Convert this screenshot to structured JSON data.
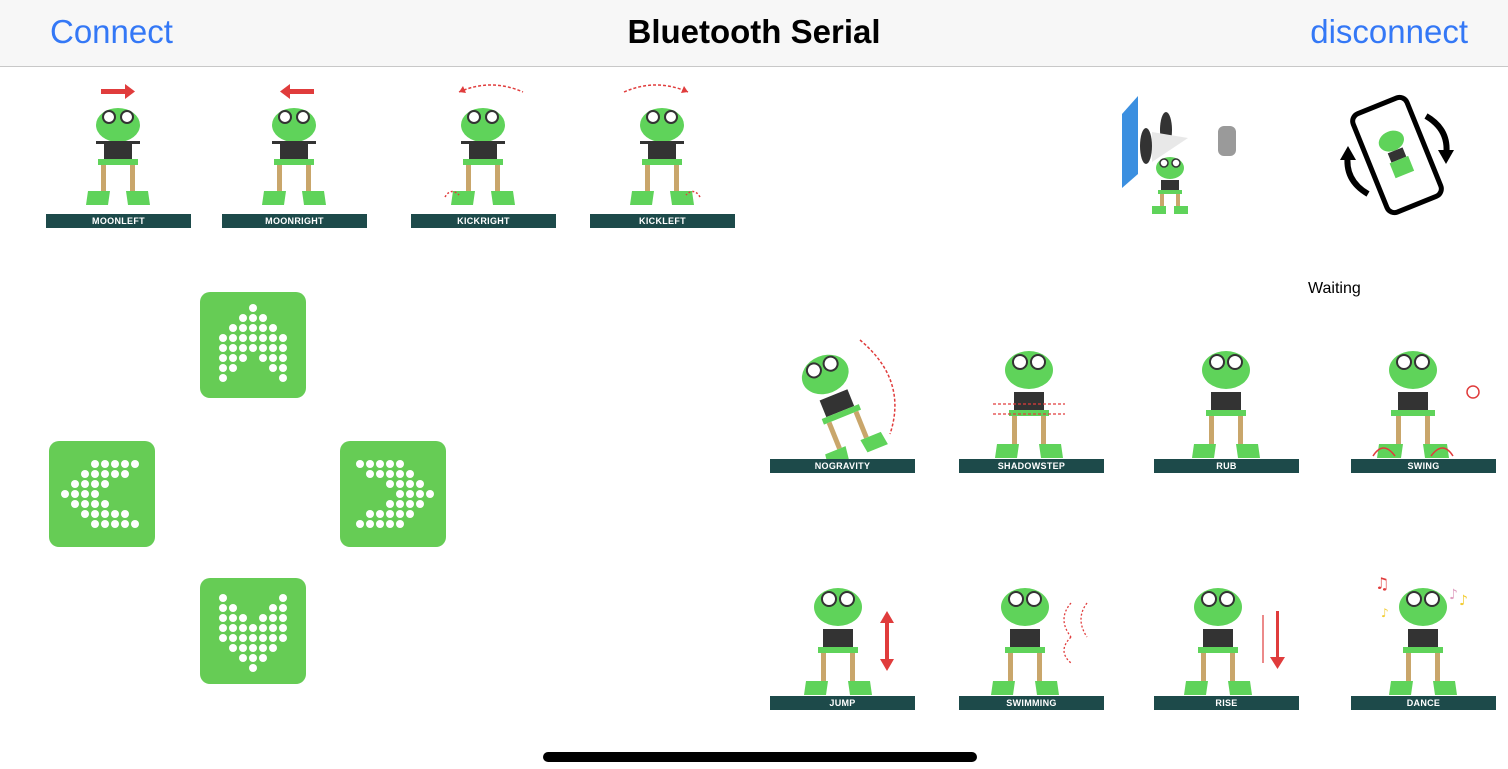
{
  "navbar": {
    "connect_label": "Connect",
    "title": "Bluetooth Serial",
    "disconnect_label": "disconnect"
  },
  "top_moves": [
    {
      "label": "MOONLEFT",
      "arrow": "right"
    },
    {
      "label": "MOONRIGHT",
      "arrow": "left"
    },
    {
      "label": "KICKRIGHT",
      "arrow": "arc-left"
    },
    {
      "label": "KICKLEFT",
      "arrow": "arc-right"
    }
  ],
  "dpad": {
    "up": "arrow-up-icon",
    "left": "arrow-left-icon",
    "right": "arrow-right-icon",
    "down": "arrow-down-icon",
    "color": "#66cc55"
  },
  "modes": {
    "avoid_icon": "ultrasonic-avoid-icon",
    "tilt_icon": "phone-rotate-icon"
  },
  "status": {
    "text": "Waiting"
  },
  "grid_moves_row1": [
    {
      "label": "NOGRAVITY"
    },
    {
      "label": "SHADOWSTEP"
    },
    {
      "label": "RUB"
    },
    {
      "label": "SWING"
    }
  ],
  "grid_moves_row2": [
    {
      "label": "JUMP"
    },
    {
      "label": "SWIMMING"
    },
    {
      "label": "RISE"
    },
    {
      "label": "DANCE"
    }
  ],
  "colors": {
    "accent": "#3478f6",
    "frog_green": "#5fd35a",
    "label_bar": "#1d4a4a",
    "arrow_red": "#e03c3c"
  }
}
